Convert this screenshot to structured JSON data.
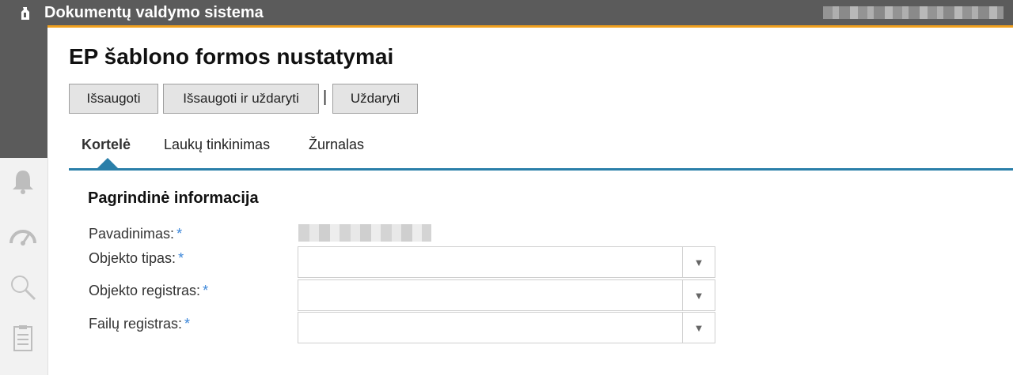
{
  "app": {
    "title": "Dokumentų valdymo sistema"
  },
  "page": {
    "title": "EP šablono formos nustatymai"
  },
  "toolbar": {
    "save_label": "Išsaugoti",
    "save_close_label": "Išsaugoti ir uždaryti",
    "separator": "|",
    "close_label": "Uždaryti"
  },
  "tabs": [
    {
      "label": "Kortelė",
      "active": true
    },
    {
      "label": "Laukų tinkinimas",
      "active": false
    },
    {
      "label": "Žurnalas",
      "active": false
    }
  ],
  "section": {
    "title": "Pagrindinė informacija"
  },
  "fields": [
    {
      "label": "Pavadinimas:",
      "required": "*"
    },
    {
      "label": "Objekto tipas:",
      "required": "*"
    },
    {
      "label": "Objekto registras:",
      "required": "*"
    },
    {
      "label": "Failų registras:",
      "required": "*"
    }
  ],
  "colors": {
    "accent": "#f0a01e",
    "tab_active": "#2a7fa9",
    "required": "#3b86d9",
    "topbar": "#5b5b5b"
  },
  "icons": [
    "app-logo-icon",
    "bell-icon",
    "dashboard-gauge-icon",
    "search-icon",
    "clipboard-icon",
    "chevron-down-icon"
  ]
}
